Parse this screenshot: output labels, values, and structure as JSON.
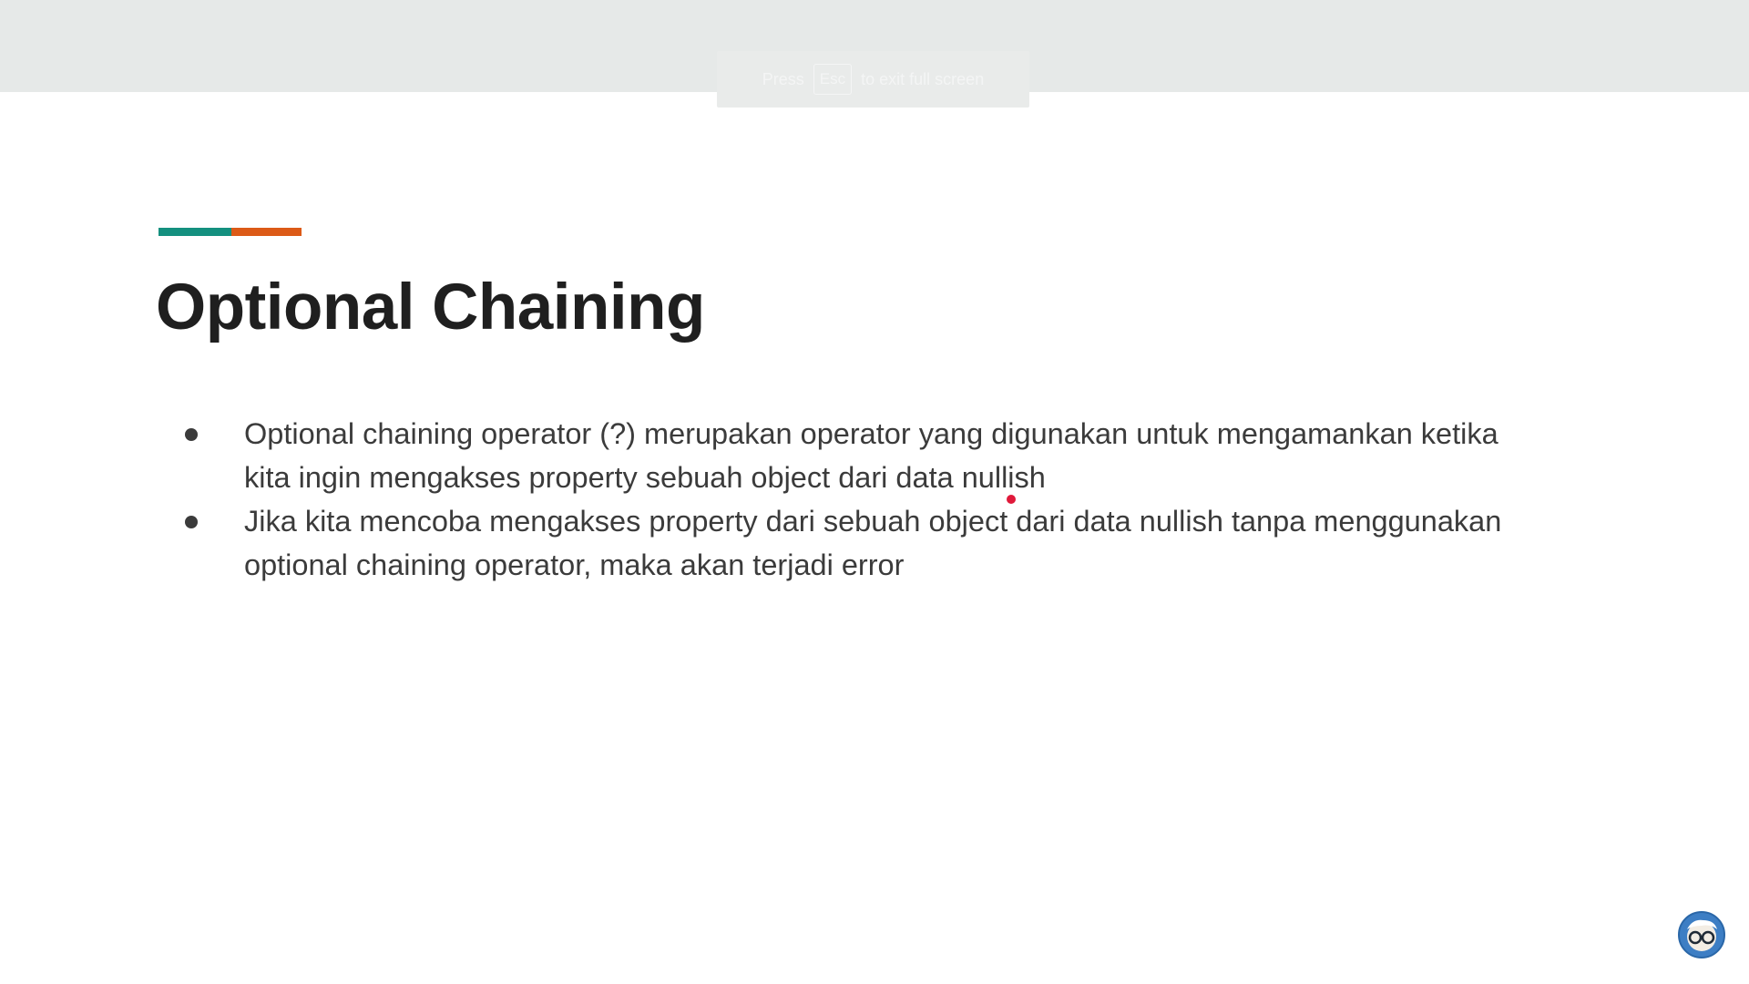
{
  "fullscreen_notice": {
    "press": "Press",
    "key": "Esc",
    "suffix": "to exit full screen"
  },
  "colors": {
    "accent_teal": "#14907f",
    "accent_orange": "#dc5a17",
    "pointer": "#e0193a",
    "logo_blue": "#3d7ec4"
  },
  "slide": {
    "title": "Optional Chaining",
    "bullets": [
      {
        "line1": "Optional chaining operator (?) merupakan operator yang digunakan untuk mengamankan ketika",
        "line2": "kita ingin mengakses property sebuah object dari data nullish"
      },
      {
        "line1": "Jika kita mencoba mengakses property dari sebuah object dari data nullish tanpa menggunakan",
        "line2": "optional chaining operator, maka akan terjadi error"
      }
    ]
  },
  "icons": {
    "bullet": "bullet-dot-icon",
    "logo": "glasses-avatar-icon"
  }
}
